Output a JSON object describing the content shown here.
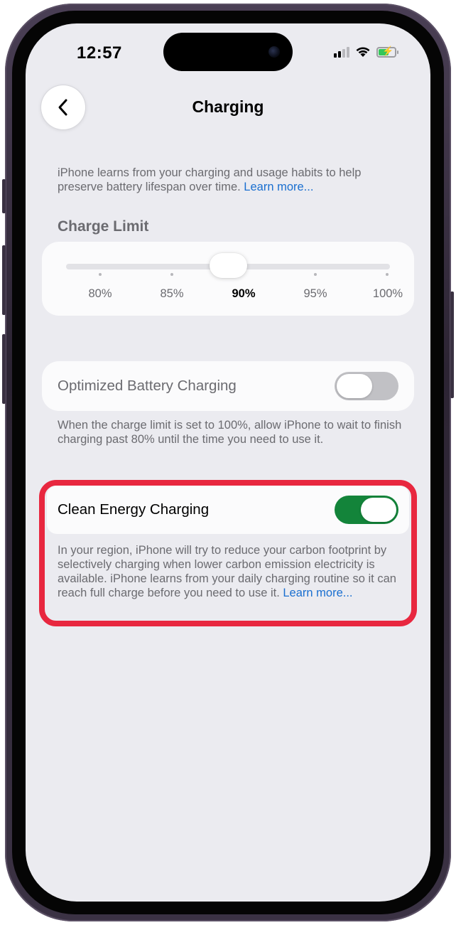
{
  "status_bar": {
    "time": "12:57",
    "battery_state": "charging",
    "colors": {
      "battery_fill": "#34c759"
    }
  },
  "nav": {
    "back_icon": "chevron-left-icon",
    "title": "Charging"
  },
  "intro": {
    "text": "iPhone learns from your charging and usage habits to help preserve battery lifespan over time. ",
    "link": "Learn more..."
  },
  "charge_limit": {
    "title": "Charge Limit",
    "options": [
      "80%",
      "85%",
      "90%",
      "95%",
      "100%"
    ],
    "selected": "90%"
  },
  "optimized": {
    "label": "Optimized Battery Charging",
    "enabled": false,
    "footnote": "When the charge limit is set to 100%, allow iPhone to wait to finish charging past 80% until the time you need to use it."
  },
  "clean_energy": {
    "label": "Clean Energy Charging",
    "enabled": true,
    "footnote": "In your region, iPhone will try to reduce your carbon footprint by selectively charging when lower carbon emission electricity is available. iPhone learns from your daily charging routine so it can reach full charge before you need to use it. ",
    "link": "Learn more...",
    "colors": {
      "toggle_on": "#13843a",
      "highlight": "#e8273f"
    }
  }
}
